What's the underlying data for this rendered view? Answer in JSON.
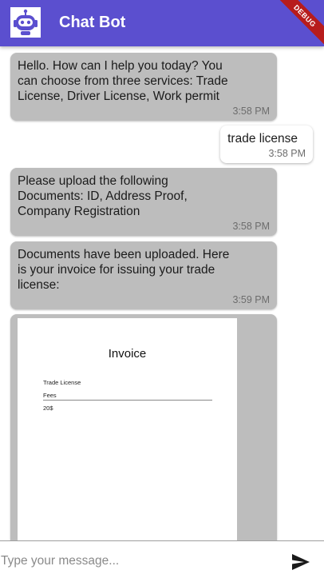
{
  "appbar": {
    "title": "Chat Bot",
    "debug_banner": "DEBUG",
    "avatar_icon": "robot-icon",
    "color": "#5b4fcf"
  },
  "messages": [
    {
      "sender": "bot",
      "text": "Hello. How can I help you today? You can choose from three services: Trade License, Driver License, Work permit",
      "time": "3:58 PM"
    },
    {
      "sender": "user",
      "text": "trade license",
      "time": "3:58 PM"
    },
    {
      "sender": "bot",
      "text": "Please upload the following Documents: ID, Address Proof, Company Registration",
      "time": "3:58 PM"
    },
    {
      "sender": "bot",
      "text": "Documents have been uploaded. Here is your invoice for issuing your trade license:",
      "time": "3:59 PM"
    }
  ],
  "invoice": {
    "title": "Invoice",
    "item": "Trade License",
    "fees_label": "Fees",
    "amount": "20$"
  },
  "composer": {
    "placeholder": "Type your message...",
    "send_icon": "send-icon"
  }
}
